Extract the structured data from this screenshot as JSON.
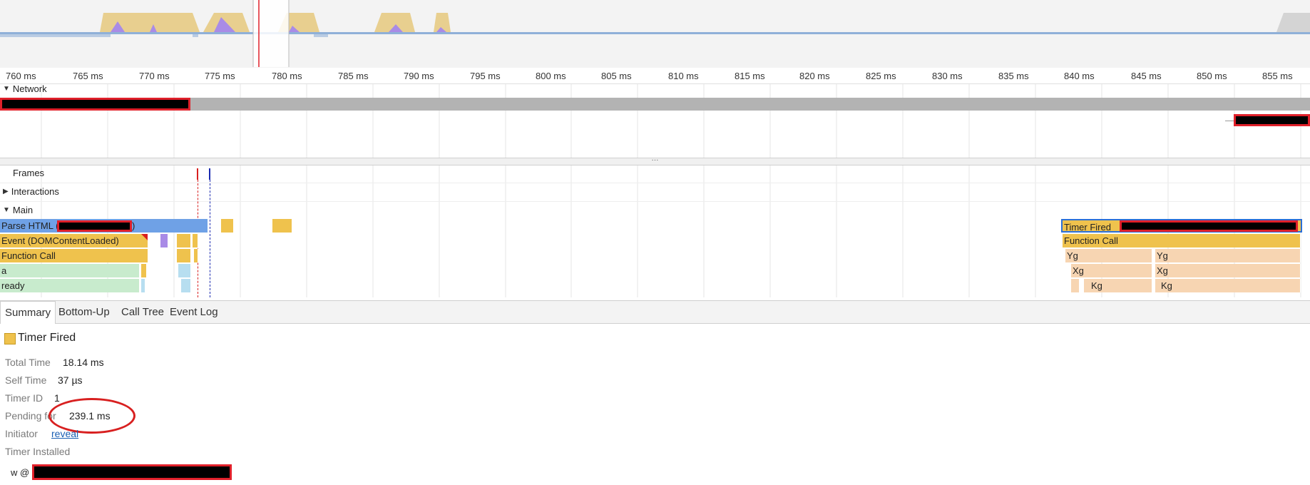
{
  "ruler": {
    "ticks": [
      "760 ms",
      "765 ms",
      "770 ms",
      "775 ms",
      "780 ms",
      "785 ms",
      "790 ms",
      "795 ms",
      "800 ms",
      "805 ms",
      "810 ms",
      "815 ms",
      "820 ms",
      "825 ms",
      "830 ms",
      "835 ms",
      "840 ms",
      "845 ms",
      "850 ms",
      "855 ms"
    ]
  },
  "tracks": {
    "network": "Network",
    "frames": "Frames",
    "interactions": "Interactions",
    "main": "Main"
  },
  "main_slices": {
    "parse_html": "Parse HTML (",
    "parse_html_close": ")",
    "event_dcl": "Event (DOMContentLoaded)",
    "function_call": "Function Call",
    "a": "a",
    "ready": "ready",
    "timer_fired": "Timer Fired",
    "function_call_2": "Function Call",
    "yg1": "Yg",
    "yg2": "Yg",
    "xg1": "Xg",
    "xg2": "Xg",
    "kg1": "Kg",
    "kg2": "Kg"
  },
  "tabs": [
    "Summary",
    "Bottom-Up",
    "Call Tree",
    "Event Log"
  ],
  "summary": {
    "title": "Timer Fired",
    "title_color": "#efc24d",
    "total_time_label": "Total Time",
    "total_time": "18.14 ms",
    "self_time_label": "Self Time",
    "self_time": "37 µs",
    "timer_id_label": "Timer ID",
    "timer_id": "1",
    "pending_for_label": "Pending for",
    "pending_for": "239.1 ms",
    "initiator_label": "Initiator",
    "initiator_link": "reveal",
    "timer_installed_label": "Timer Installed",
    "stack_frame": "w @"
  },
  "colors": {
    "redaction": "#000000",
    "annotation": "#e0202a",
    "selection_border": "#2b6fd6"
  }
}
